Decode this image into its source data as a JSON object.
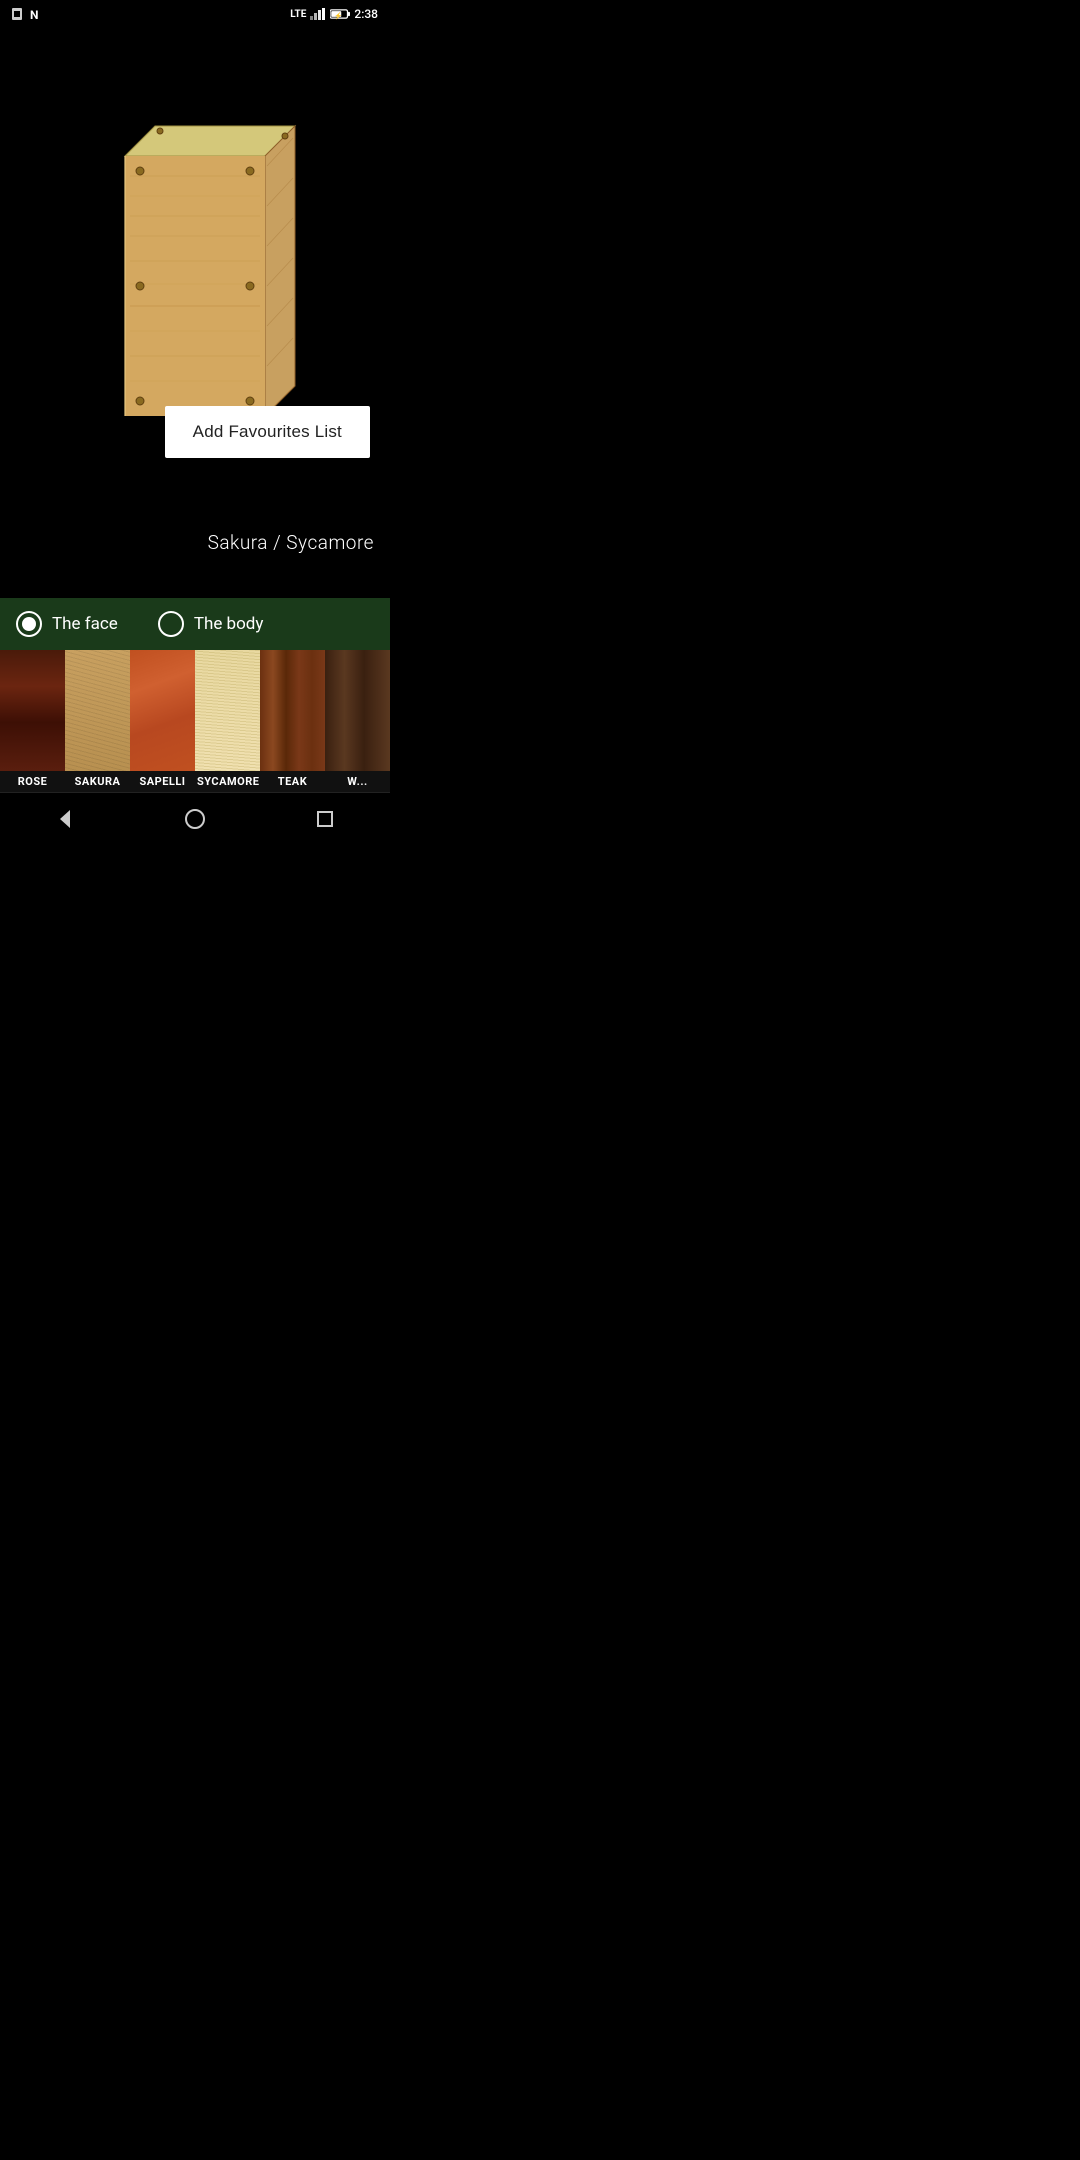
{
  "statusBar": {
    "time": "2:38",
    "icons": [
      "sim-card-icon",
      "notification-icon",
      "lte-icon",
      "signal-icon",
      "battery-icon"
    ]
  },
  "addFavBtn": {
    "label": "Add Favourites List"
  },
  "selectionLabel": {
    "text": "Sakura / Sycamore"
  },
  "radioOptions": [
    {
      "id": "face",
      "label": "The face",
      "selected": true
    },
    {
      "id": "body",
      "label": "The body",
      "selected": false
    }
  ],
  "swatches": [
    {
      "id": "rose",
      "label": "ROSE",
      "woodClass": "wood-rose",
      "partial": true
    },
    {
      "id": "sakura",
      "label": "SAKURA",
      "woodClass": "wood-sakura"
    },
    {
      "id": "sapelli",
      "label": "SAPELLI",
      "woodClass": "wood-sapelli"
    },
    {
      "id": "sycamore",
      "label": "SYCAMORE",
      "woodClass": "wood-sycamore"
    },
    {
      "id": "teak",
      "label": "TEAK",
      "woodClass": "wood-teak"
    },
    {
      "id": "extra",
      "label": "W...",
      "woodClass": "wood-extra",
      "partial": true
    }
  ],
  "navBar": {
    "back": "◁",
    "home": "○",
    "recents": "□"
  }
}
